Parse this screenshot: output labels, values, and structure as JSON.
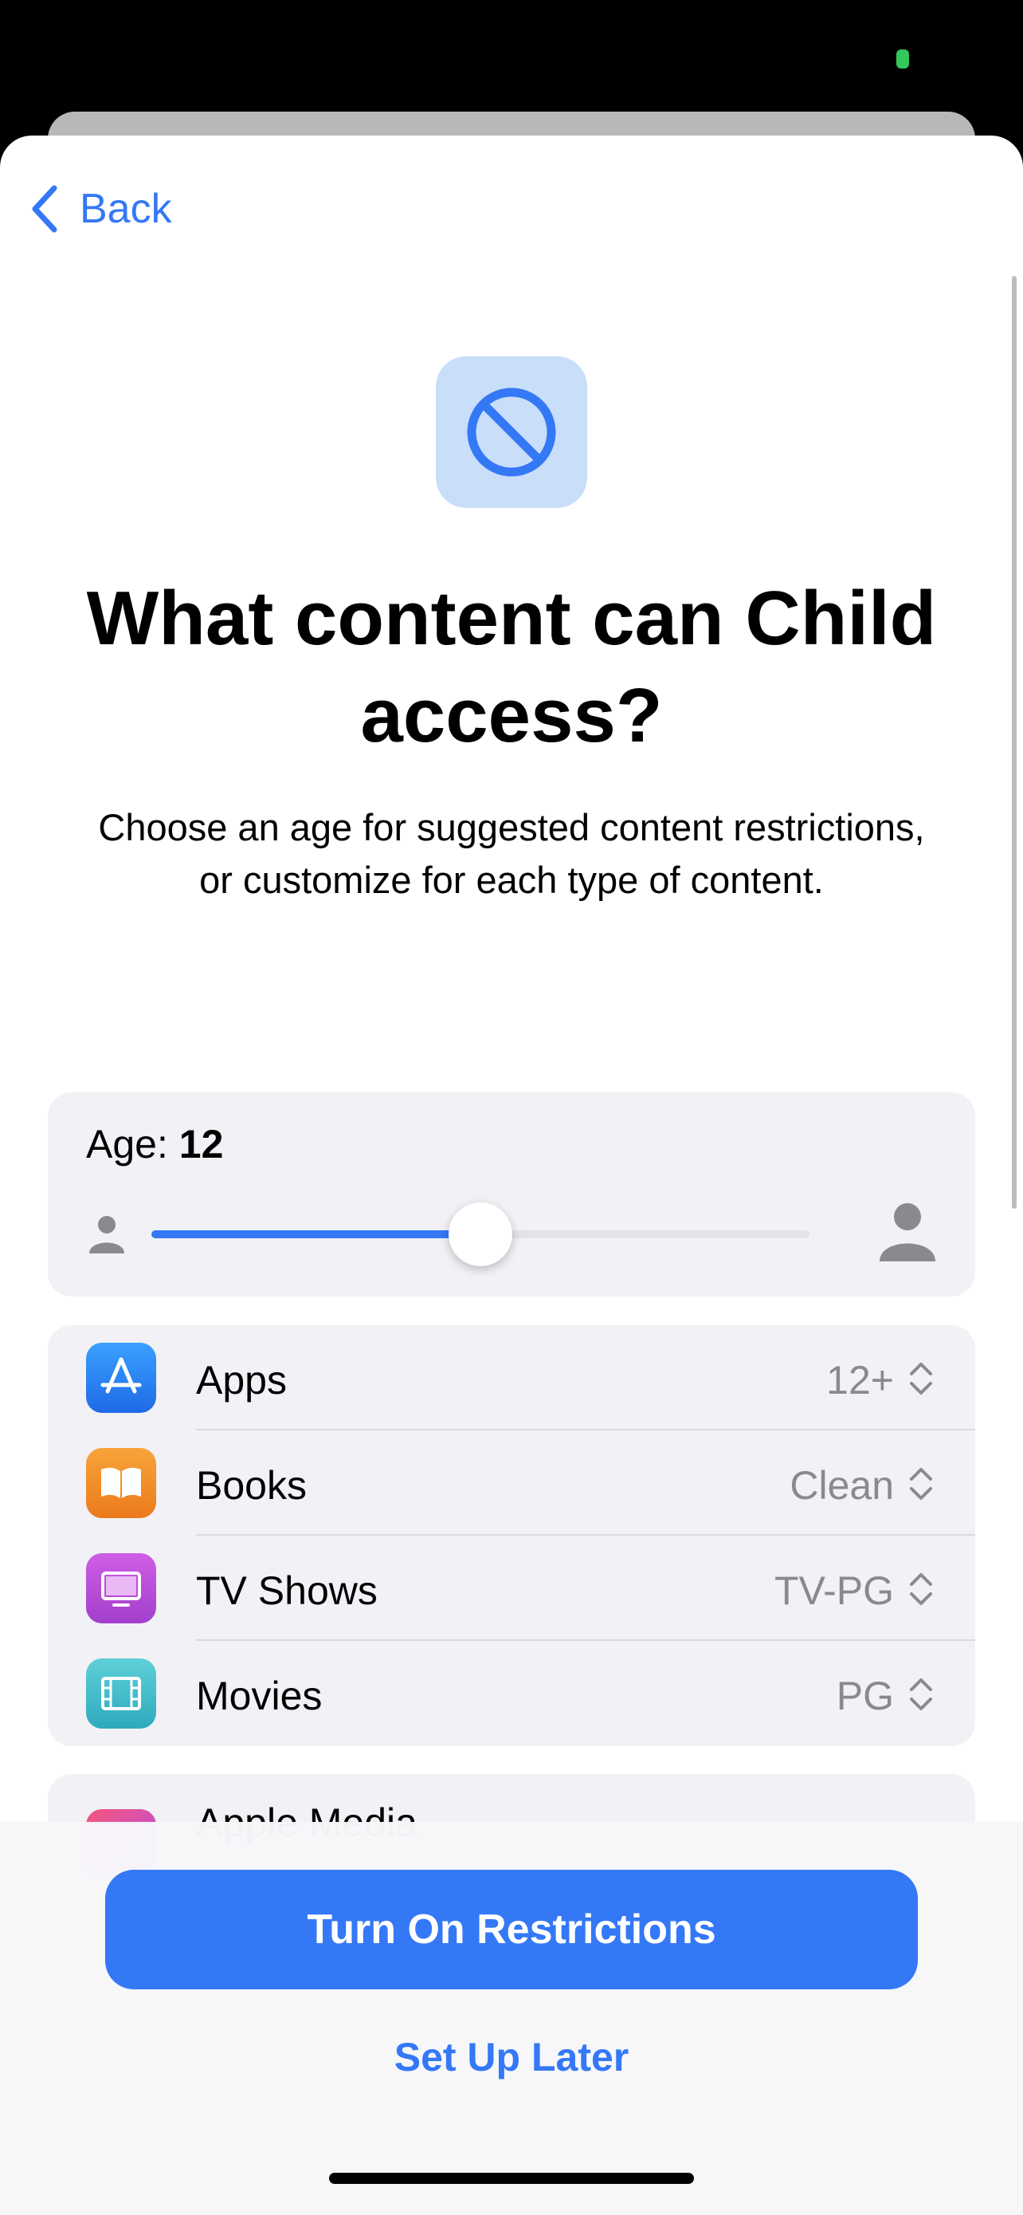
{
  "nav": {
    "back_label": "Back"
  },
  "header": {
    "title": "What content can Child access?",
    "subtitle": "Choose an age for suggested content restrictions, or customize for each type of content."
  },
  "age": {
    "label": "Age:",
    "value": "12",
    "slider_fraction": 0.5
  },
  "content_types": [
    {
      "label": "Apps",
      "value": "12+",
      "icon": "app-store-icon",
      "color": "#2f7cf6"
    },
    {
      "label": "Books",
      "value": "Clean",
      "icon": "books-icon",
      "color": "#f08a24"
    },
    {
      "label": "TV Shows",
      "value": "TV-PG",
      "icon": "tv-icon",
      "color": "#b84fd8"
    },
    {
      "label": "Movies",
      "value": "PG",
      "icon": "film-icon",
      "color": "#39b8c8"
    }
  ],
  "partial_row": {
    "label": "Apple Media"
  },
  "actions": {
    "primary": "Turn On Restrictions",
    "secondary": "Set Up Later"
  },
  "colors": {
    "accent": "#3478f6",
    "card": "#f1f1f6"
  }
}
